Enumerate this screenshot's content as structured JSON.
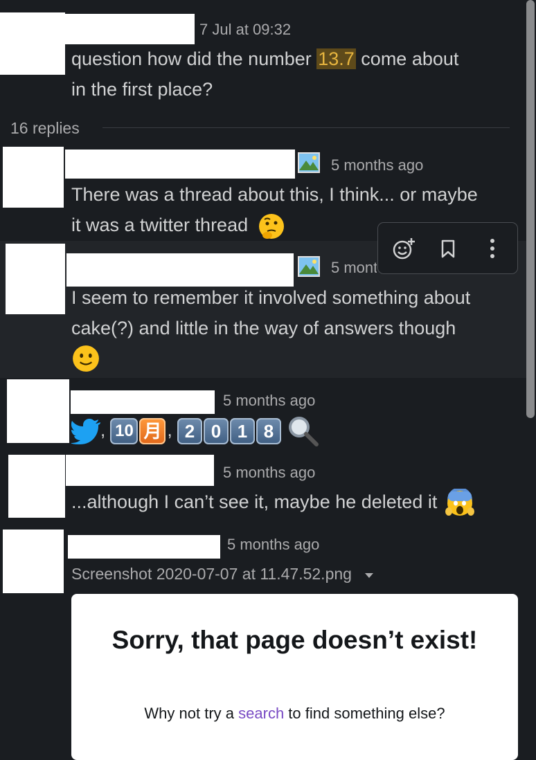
{
  "thread": {
    "parent": {
      "timestamp": "7 Jul at 09:32",
      "text_line1_pre": "question how did the number ",
      "text_highlight": "13.7",
      "text_line1_post": " come about",
      "text_line2": "in the first place?"
    },
    "replies_count_label": "16 replies"
  },
  "replies": [
    {
      "timestamp": "5 months ago",
      "line1": "There was a thread about this, I think... or maybe",
      "line2": "it was a twitter thread"
    },
    {
      "timestamp": "5 months ago",
      "line1": "I seem to remember it involved something about",
      "line2": "cake(?) and little in the way of answers though"
    },
    {
      "timestamp": "5 months ago",
      "sep1": ",",
      "month_num": "10",
      "month_char": "月",
      "sep2": ",",
      "year_digits": [
        "2",
        "0",
        "1",
        "8"
      ]
    },
    {
      "timestamp": "5 months ago",
      "text": "...although I can’t see it, maybe he deleted it"
    },
    {
      "timestamp": "5 months ago",
      "file_name": "Screenshot 2020-07-07 at 11.47.52.png"
    }
  ],
  "attachment": {
    "title": "Sorry, that page doesn’t exist!",
    "sub_pre": "Why not try a ",
    "sub_link": "search",
    "sub_post": " to find something else?"
  },
  "icons": {
    "thumbnail": "landscape-image-icon",
    "toolbar": [
      "add-reaction-icon",
      "bookmark-icon",
      "more-actions-icon"
    ]
  },
  "colors": {
    "background": "#1a1d21",
    "highlight_bg": "#5e4a1a",
    "highlight_text": "#e8b63f",
    "link": "#794bc4"
  }
}
